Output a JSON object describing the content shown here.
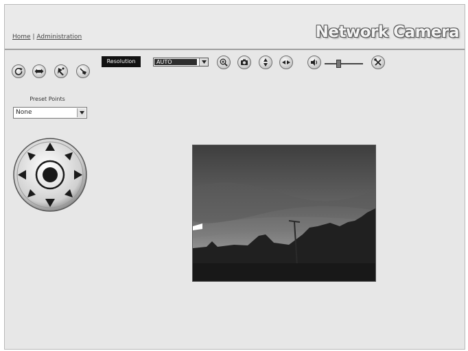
{
  "header": {
    "nav": {
      "home": "Home",
      "separator": "|",
      "administration": "Administration"
    },
    "brand": "Network Camera"
  },
  "toolbar": {
    "left_icons": [
      "refresh-icon",
      "flip-icon",
      "patrol-icon",
      "auto-pan-icon"
    ],
    "resolution_label": "Resolution",
    "resolution_value": "AUTO",
    "camera_icons": [
      "zoom-icon",
      "snapshot-icon",
      "vertical-flip-icon",
      "horizontal-flip-icon",
      "speaker-icon"
    ],
    "volume_level": 0.35,
    "settings_icon": "tools-icon"
  },
  "preset": {
    "label": "Preset Points",
    "value": "None"
  },
  "ptz": {
    "directions": [
      "up",
      "down",
      "left",
      "right",
      "up-left",
      "up-right",
      "down-left",
      "down-right",
      "center"
    ]
  },
  "video": {
    "description_icon": "live-video"
  },
  "colors": {
    "background": "#e7e7e7",
    "header_border": "#9d9d9d",
    "resolution_label_bg": "#111111"
  }
}
